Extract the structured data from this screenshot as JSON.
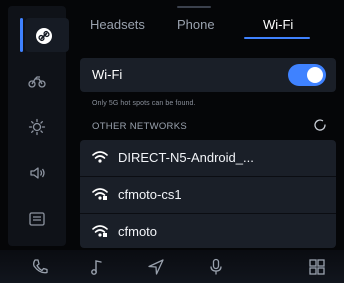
{
  "tabs": [
    {
      "label": "Headsets",
      "active": false
    },
    {
      "label": "Phone",
      "active": false
    },
    {
      "label": "Wi-Fi",
      "active": true
    }
  ],
  "sidebar": {
    "items": [
      {
        "icon": "link-icon",
        "active": true
      },
      {
        "icon": "motorcycle-icon",
        "active": false
      },
      {
        "icon": "brightness-icon",
        "active": false
      },
      {
        "icon": "volume-icon",
        "active": false
      },
      {
        "icon": "keyboard-icon",
        "active": false
      }
    ]
  },
  "wifi": {
    "label": "Wi-Fi",
    "enabled": true,
    "hint": "Only 5G hot spots can be found.",
    "section_title": "OTHER NETWORKS"
  },
  "networks": [
    {
      "name": "DIRECT-N5-Android_..."
    },
    {
      "name": "cfmoto-cs1"
    },
    {
      "name": "cfmoto"
    }
  ],
  "bottom_bar": {
    "items": [
      "phone-icon",
      "music-icon",
      "navigation-icon",
      "microphone-icon",
      "apps-grid-icon"
    ]
  },
  "colors": {
    "accent": "#3f82ff",
    "background": "#050608",
    "panel": "#1a1f28"
  }
}
